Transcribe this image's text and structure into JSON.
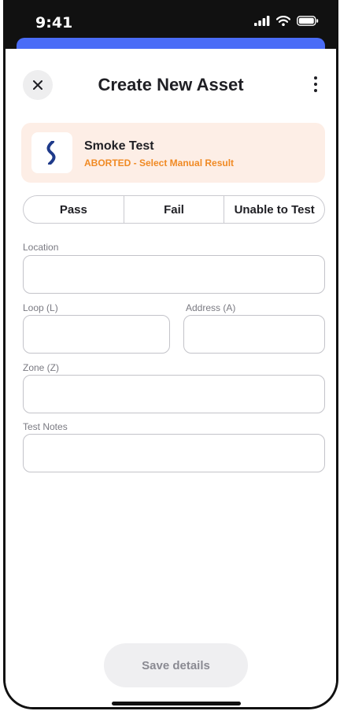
{
  "status_bar": {
    "time": "9:41",
    "icons": [
      "signal-icon",
      "wifi-icon",
      "battery-icon"
    ]
  },
  "header": {
    "title": "Create New Asset",
    "close_icon": "close-icon",
    "more_icon": "more-vertical-icon"
  },
  "test_card": {
    "name": "Smoke Test",
    "status": "ABORTED - Select Manual Result",
    "icon": "smoke-icon",
    "colors": {
      "background": "#fdeee6",
      "status": "#f08a24",
      "icon": "#1e3a8a"
    }
  },
  "result_options": [
    {
      "label": "Pass"
    },
    {
      "label": "Fail"
    },
    {
      "label": "Unable to Test"
    }
  ],
  "form": {
    "location": {
      "label": "Location",
      "value": ""
    },
    "loop": {
      "label": "Loop (L)",
      "value": ""
    },
    "address": {
      "label": "Address (A)",
      "value": ""
    },
    "zone": {
      "label": "Zone (Z)",
      "value": ""
    },
    "test_notes": {
      "label": "Test Notes",
      "value": ""
    }
  },
  "save_button": {
    "label": "Save details",
    "enabled": false
  },
  "colors": {
    "accent": "#4a6cf7",
    "disabled_button": "#efeff1"
  }
}
